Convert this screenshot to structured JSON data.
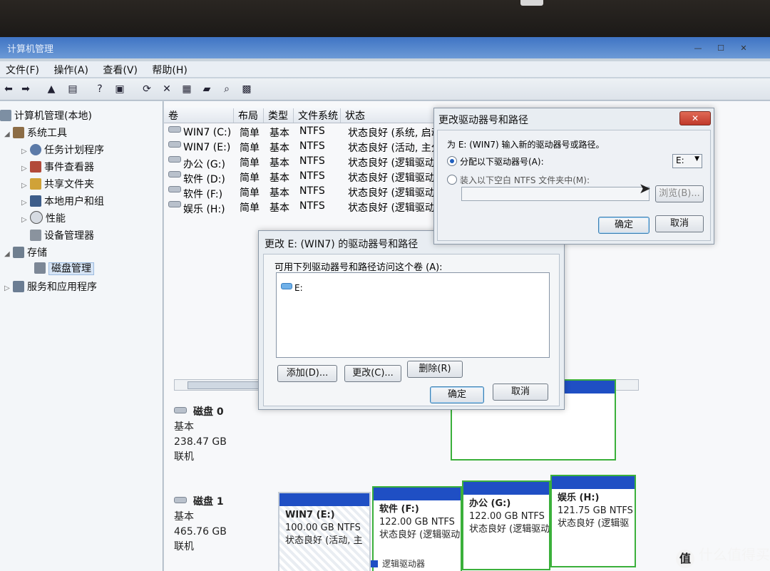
{
  "window": {
    "title": "计算机管理"
  },
  "menu": [
    "文件(F)",
    "操作(A)",
    "查看(V)",
    "帮助(H)"
  ],
  "tree": {
    "root": "计算机管理(本地)",
    "system_tools": "系统工具",
    "system_items": [
      "任务计划程序",
      "事件查看器",
      "共享文件夹",
      "本地用户和组",
      "性能",
      "设备管理器"
    ],
    "storage": "存储",
    "disk_mgmt": "磁盘管理",
    "services": "服务和应用程序"
  },
  "volume_list": {
    "headers": [
      "卷",
      "布局",
      "类型",
      "文件系统",
      "状态"
    ],
    "rows": [
      [
        "WIN7 (C:)",
        "简单",
        "基本",
        "NTFS",
        "状态良好 (系统, 启动"
      ],
      [
        "WIN7 (E:)",
        "简单",
        "基本",
        "NTFS",
        "状态良好 (活动, 主分"
      ],
      [
        "办公 (G:)",
        "简单",
        "基本",
        "NTFS",
        "状态良好 (逻辑驱动器"
      ],
      [
        "软件 (D:)",
        "简单",
        "基本",
        "NTFS",
        "状态良好 (逻辑驱动器"
      ],
      [
        "软件 (F:)",
        "简单",
        "基本",
        "NTFS",
        "状态良好 (逻辑驱动器"
      ],
      [
        "娱乐 (H:)",
        "简单",
        "基本",
        "NTFS",
        "状态良好 (逻辑驱动器"
      ]
    ]
  },
  "disks": [
    {
      "name": "磁盘 0",
      "type": "基本",
      "size": "238.47 GB",
      "status": "联机"
    },
    {
      "name": "磁盘 1",
      "type": "基本",
      "size": "465.76 GB",
      "status": "联机"
    }
  ],
  "disk1_partitions": [
    {
      "name": "WIN7 (E:)",
      "size": "100.00 GB NTFS",
      "status": "状态良好 (活动, 主"
    },
    {
      "name": "软件 (F:)",
      "size": "122.00 GB NTFS",
      "status": "状态良好 (逻辑驱动"
    },
    {
      "name": "办公 (G:)",
      "size": "122.00 GB NTFS",
      "status": "状态良好 (逻辑驱动"
    },
    {
      "name": "娱乐 (H:)",
      "size": "121.75 GB NTFS",
      "status": "状态良好 (逻辑驱"
    }
  ],
  "legend": {
    "logical": "逻辑驱动器"
  },
  "dialog_paths": {
    "title": "更改 E: (WIN7) 的驱动器号和路径",
    "label": "可用下列驱动器号和路径访问这个卷 (A):",
    "entry": "E:",
    "add": "添加(D)...",
    "change": "更改(C)...",
    "remove": "删除(R)",
    "ok": "确定",
    "cancel": "取消"
  },
  "dialog_change": {
    "title": "更改驱动器号和路径",
    "prompt": "为 E: (WIN7) 输入新的驱动器号或路径。",
    "assign_label": "分配以下驱动器号(A):",
    "assign_value": "E:",
    "mount_label": "装入以下空白 NTFS 文件夹中(M):",
    "browse": "浏览(B)...",
    "ok": "确定",
    "cancel": "取消"
  },
  "watermark": "什么值得买",
  "watermark_logo": "值"
}
